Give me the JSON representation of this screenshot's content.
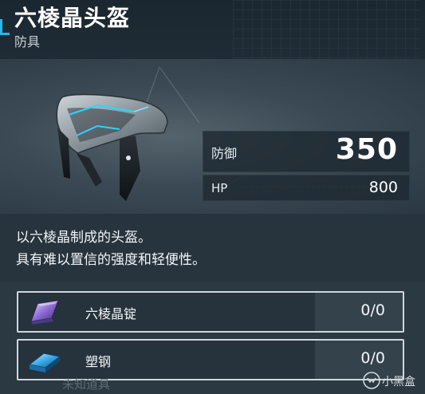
{
  "item": {
    "name": "六棱晶头盔",
    "category": "防具"
  },
  "stats": {
    "defense_label": "防御",
    "defense_value": "350",
    "hp_label": "HP",
    "hp_value": "800"
  },
  "description": {
    "line1": "以六棱晶制成的头盔。",
    "line2": "具有难以置信的强度和轻便性。"
  },
  "materials": [
    {
      "name": "六棱晶锭",
      "count": "0/0",
      "icon": "crystal-ingot-icon"
    },
    {
      "name": "塑钢",
      "count": "0/0",
      "icon": "plasteel-icon"
    }
  ],
  "ghost_text": "未知道具",
  "watermark": {
    "text": "小黑盒",
    "icon": "heybox-logo"
  },
  "colors": {
    "accent": "#2ab6f0",
    "background": "#1e2a33",
    "panel": "#27343e",
    "text": "#f3f6f8"
  }
}
